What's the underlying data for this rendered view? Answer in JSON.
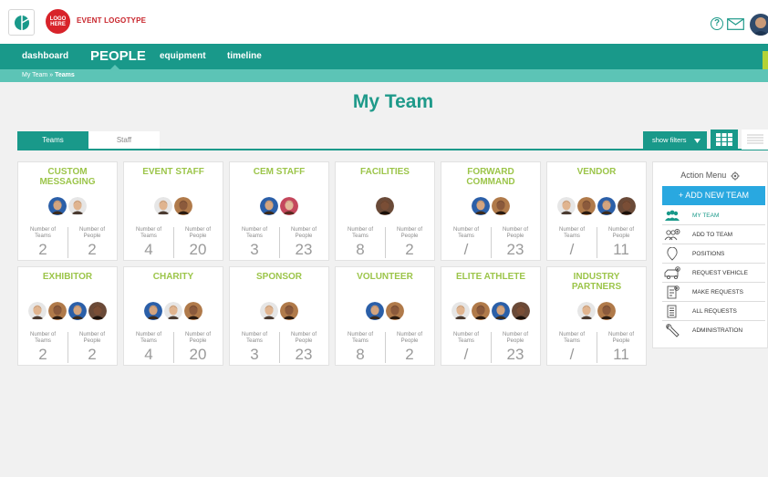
{
  "brand": {
    "logo_text": "LOGO HERE",
    "event_logotype": "EVENT LOGOTYPE"
  },
  "header_icons": [
    "help-icon",
    "mail-icon",
    "user-avatar"
  ],
  "nav": {
    "items": [
      {
        "label": "dashboard"
      },
      {
        "label": "PEOPLE",
        "active": true
      },
      {
        "label": "equipment"
      },
      {
        "label": "timeline"
      }
    ]
  },
  "breadcrumb": {
    "root": "My Team",
    "separator": " » ",
    "current": "Teams"
  },
  "page_title": "My Team",
  "tabs": [
    {
      "label": "Teams",
      "active": true
    },
    {
      "label": "Staff",
      "active": false
    }
  ],
  "toolbar": {
    "filters_label": "show filters",
    "view_modes": [
      "grid-view",
      "list-view"
    ]
  },
  "stat_labels": {
    "teams": "Number of Teams",
    "people": "Number of People"
  },
  "cards": [
    {
      "title": "CUSTOM MESSAGING",
      "teams": "2",
      "people": "2",
      "avatars": [
        "blue",
        "grey"
      ]
    },
    {
      "title": "EVENT STAFF",
      "teams": "4",
      "people": "20",
      "avatars": [
        "grey",
        "brown"
      ]
    },
    {
      "title": "CEM STAFF",
      "teams": "3",
      "people": "23",
      "avatars": [
        "blue",
        "rose"
      ]
    },
    {
      "title": "FACILITIES",
      "teams": "8",
      "people": "2",
      "avatars": [
        "dark"
      ]
    },
    {
      "title": "FORWARD COMMAND",
      "teams": "/",
      "people": "23",
      "avatars": [
        "blue",
        "brown"
      ]
    },
    {
      "title": "VENDOR",
      "teams": "/",
      "people": "11",
      "avatars": [
        "grey",
        "brown",
        "blue",
        "dark"
      ]
    },
    {
      "title": "EXHIBITOR",
      "teams": "2",
      "people": "2",
      "avatars": [
        "grey",
        "brown",
        "blue",
        "dark"
      ]
    },
    {
      "title": "CHARITY",
      "teams": "4",
      "people": "20",
      "avatars": [
        "blue",
        "grey",
        "brown"
      ]
    },
    {
      "title": "SPONSOR",
      "teams": "3",
      "people": "23",
      "avatars": [
        "grey",
        "brown"
      ]
    },
    {
      "title": "VOLUNTEER",
      "teams": "8",
      "people": "2",
      "avatars": [
        "blue",
        "brown"
      ]
    },
    {
      "title": "ELITE ATHLETE",
      "teams": "/",
      "people": "23",
      "avatars": [
        "grey",
        "brown",
        "blue",
        "dark"
      ]
    },
    {
      "title": "INDUSTRY PARTNERS",
      "teams": "/",
      "people": "11",
      "avatars": [
        "grey",
        "brown"
      ]
    }
  ],
  "action_menu": {
    "title": "Action Menu",
    "add_button": "+ ADD NEW TEAM",
    "items": [
      {
        "label": "MY TEAM",
        "icon": "team-icon",
        "active": true
      },
      {
        "label": "ADD TO TEAM",
        "icon": "add-person-icon"
      },
      {
        "label": "POSITIONS",
        "icon": "location-pin-icon"
      },
      {
        "label": "REQUEST VEHICLE",
        "icon": "vehicle-icon"
      },
      {
        "label": "MAKE REQUESTS",
        "icon": "request-doc-icon"
      },
      {
        "label": "ALL REQUESTS",
        "icon": "list-doc-icon"
      },
      {
        "label": "ADMINISTRATION",
        "icon": "wrench-icon"
      }
    ]
  },
  "colors": {
    "teal": "#19998a",
    "teal_light": "#5cc4b6",
    "green_title": "#9cc54a",
    "blue_button": "#29a8e0",
    "logo_red": "#d8232a"
  }
}
